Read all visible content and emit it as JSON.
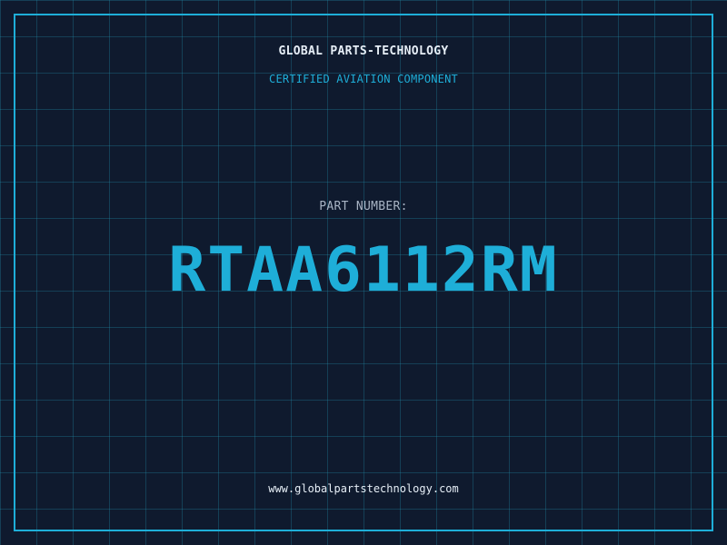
{
  "colors": {
    "background": "#0f1a2e",
    "accent": "#1eaed8",
    "text": "#e6eef6",
    "muted": "#a8b4c4"
  },
  "header": {
    "brand": "GLOBAL PARTS-TECHNOLOGY",
    "subtitle": "CERTIFIED AVIATION COMPONENT"
  },
  "part": {
    "label": "PART NUMBER:",
    "number": "RTAA6112RM"
  },
  "footer": {
    "website": "www.globalpartstechnology.com"
  }
}
